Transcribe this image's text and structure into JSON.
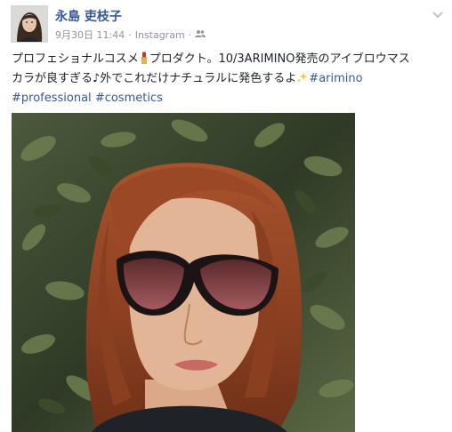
{
  "post": {
    "author": "永島 吏枝子",
    "date": "9月30日 11:44",
    "separator": "·",
    "via": "Instagram",
    "text_line1_before": "プロフェショナルコスメ",
    "text_line1_after": "プロダクト。10/3ARIMINO発売のアイブロウマス",
    "text_line2": "カラが良すぎる♪外でこれだけナチュラルに発色するよ",
    "hashtags": [
      "#arimino",
      "#professional",
      "#cosmetics"
    ]
  },
  "icons": {
    "lipstick": "lipstick-icon",
    "sparkles": "sparkles-icon",
    "audience": "friends-audience-icon",
    "menu": "chevron-down-icon"
  }
}
